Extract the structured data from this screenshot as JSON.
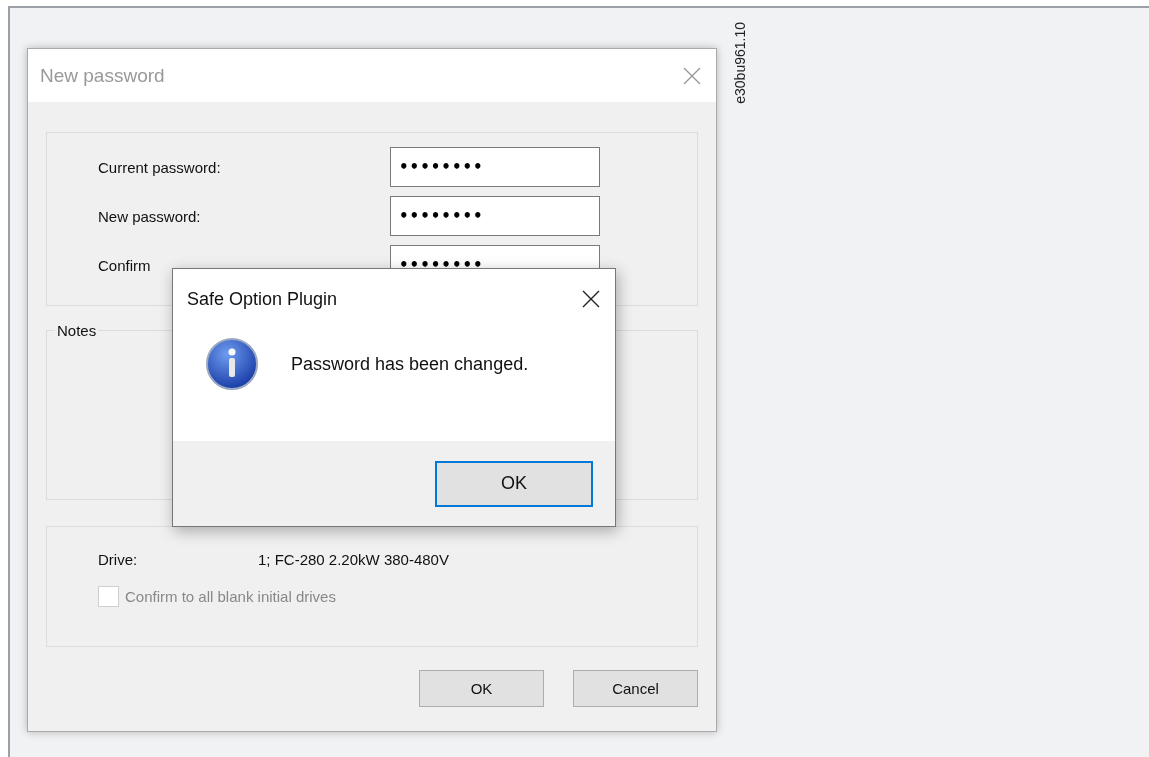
{
  "figure_id": "e30bu961.10",
  "dialog": {
    "title": "New password",
    "fields": [
      {
        "label": "Current password:",
        "value": "••••••••"
      },
      {
        "label": "New password:",
        "value": "••••••••"
      },
      {
        "label": "Confirm",
        "value": "••••••••"
      }
    ],
    "notes_group": {
      "title": "Notes"
    },
    "drive": {
      "label": "Drive:",
      "value": "1; FC-280 2.20kW 380-480V"
    },
    "confirm_all": {
      "label": "Confirm to all blank initial drives",
      "checked": false,
      "disabled": true
    },
    "buttons": [
      "OK",
      "Cancel"
    ]
  },
  "message_box": {
    "title": "Safe Option Plugin",
    "message": "Password has been changed.",
    "buttons": [
      {
        "label": "OK",
        "focused": true
      }
    ]
  }
}
